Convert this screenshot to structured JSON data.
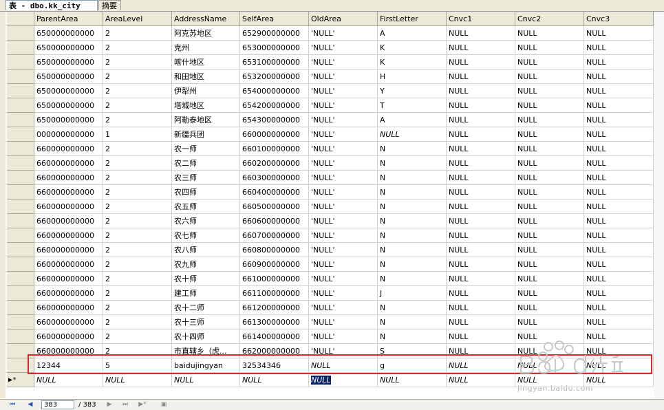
{
  "tabs": [
    {
      "label": "表 - dbo.kk_city",
      "active": true
    },
    {
      "label": "摘要",
      "active": false
    }
  ],
  "columns": [
    "ParentArea",
    "AreaLevel",
    "AddressName",
    "SelfArea",
    "OldArea",
    "FirstLetter",
    "Cnvc1",
    "Cnvc2",
    "Cnvc3"
  ],
  "rows": [
    [
      "650000000000",
      "2",
      "阿克苏地区",
      "652900000000",
      "'NULL'",
      "A",
      "NULL",
      "NULL",
      "NULL"
    ],
    [
      "650000000000",
      "2",
      "克州",
      "653000000000",
      "'NULL'",
      "K",
      "NULL",
      "NULL",
      "NULL"
    ],
    [
      "650000000000",
      "2",
      "喀什地区",
      "653100000000",
      "'NULL'",
      "K",
      "NULL",
      "NULL",
      "NULL"
    ],
    [
      "650000000000",
      "2",
      "和田地区",
      "653200000000",
      "'NULL'",
      "H",
      "NULL",
      "NULL",
      "NULL"
    ],
    [
      "650000000000",
      "2",
      "伊犁州",
      "654000000000",
      "'NULL'",
      "Y",
      "NULL",
      "NULL",
      "NULL"
    ],
    [
      "650000000000",
      "2",
      "塔城地区",
      "654200000000",
      "'NULL'",
      "T",
      "NULL",
      "NULL",
      "NULL"
    ],
    [
      "650000000000",
      "2",
      "阿勒泰地区",
      "654300000000",
      "'NULL'",
      "A",
      "NULL",
      "NULL",
      "NULL"
    ],
    [
      "000000000000",
      "1",
      "新疆兵团",
      "660000000000",
      "'NULL'",
      "NULL",
      "NULL",
      "NULL",
      "NULL"
    ],
    [
      "660000000000",
      "2",
      "农一师",
      "660100000000",
      "'NULL'",
      "N",
      "NULL",
      "NULL",
      "NULL"
    ],
    [
      "660000000000",
      "2",
      "农二师",
      "660200000000",
      "'NULL'",
      "N",
      "NULL",
      "NULL",
      "NULL"
    ],
    [
      "660000000000",
      "2",
      "农三师",
      "660300000000",
      "'NULL'",
      "N",
      "NULL",
      "NULL",
      "NULL"
    ],
    [
      "660000000000",
      "2",
      "农四师",
      "660400000000",
      "'NULL'",
      "N",
      "NULL",
      "NULL",
      "NULL"
    ],
    [
      "660000000000",
      "2",
      "农五师",
      "660500000000",
      "'NULL'",
      "N",
      "NULL",
      "NULL",
      "NULL"
    ],
    [
      "660000000000",
      "2",
      "农六师",
      "660600000000",
      "'NULL'",
      "N",
      "NULL",
      "NULL",
      "NULL"
    ],
    [
      "660000000000",
      "2",
      "农七师",
      "660700000000",
      "'NULL'",
      "N",
      "NULL",
      "NULL",
      "NULL"
    ],
    [
      "660000000000",
      "2",
      "农八师",
      "660800000000",
      "'NULL'",
      "N",
      "NULL",
      "NULL",
      "NULL"
    ],
    [
      "660000000000",
      "2",
      "农九师",
      "660900000000",
      "'NULL'",
      "N",
      "NULL",
      "NULL",
      "NULL"
    ],
    [
      "660000000000",
      "2",
      "农十师",
      "661000000000",
      "'NULL'",
      "N",
      "NULL",
      "NULL",
      "NULL"
    ],
    [
      "660000000000",
      "2",
      "建工师",
      "661100000000",
      "'NULL'",
      "J",
      "NULL",
      "NULL",
      "NULL"
    ],
    [
      "660000000000",
      "2",
      "农十二师",
      "661200000000",
      "'NULL'",
      "N",
      "NULL",
      "NULL",
      "NULL"
    ],
    [
      "660000000000",
      "2",
      "农十三师",
      "661300000000",
      "'NULL'",
      "N",
      "NULL",
      "NULL",
      "NULL"
    ],
    [
      "660000000000",
      "2",
      "农十四师",
      "661400000000",
      "'NULL'",
      "N",
      "NULL",
      "NULL",
      "NULL"
    ],
    [
      "660000000000",
      "2",
      "市直辖乡（虎...",
      "662000000000",
      "'NULL'",
      "S",
      "NULL",
      "NULL",
      "NULL"
    ],
    [
      "12344",
      "5",
      "baidujingyan",
      "32534346",
      "NULL",
      "g",
      "NULL",
      "NULL",
      "NULL"
    ]
  ],
  "new_row_marker": "▶*",
  "new_row": [
    "NULL",
    "NULL",
    "NULL",
    "NULL",
    "NULL",
    "NULL",
    "NULL",
    "NULL",
    "NULL"
  ],
  "navigator": {
    "first_icon": "first-record-icon",
    "prev_icon": "prev-record-icon",
    "current": "383",
    "total": "/ 383",
    "next_icon": "next-record-icon",
    "last_icon": "last-record-icon",
    "new_icon": "new-record-icon",
    "stop_icon": "stop-icon"
  },
  "watermark": {
    "text": "jingyan.baidu.com"
  },
  "colors": {
    "highlight_box": "#e0262c",
    "selection": "#0a246a",
    "header_bg": "#ece9d8"
  }
}
